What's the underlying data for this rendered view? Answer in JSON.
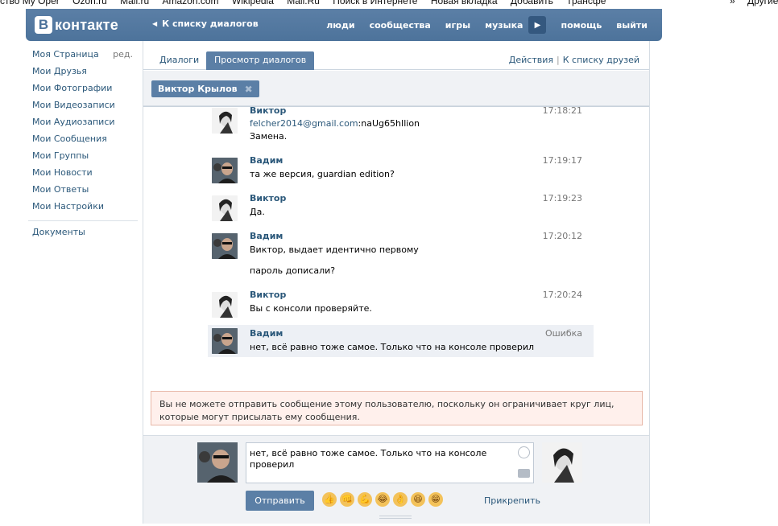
{
  "bookmarks": {
    "items": [
      "ство My Oper",
      "Ozon.ru",
      "Mail.ru",
      "Amazon.com",
      "Wikipedia",
      "Mail.Ru",
      "Поиск в Интернете",
      "Новая вкладка",
      "Добавить",
      "Трансфе"
    ],
    "more": "»",
    "other": "Другие"
  },
  "header": {
    "logo_letter": "B",
    "logo_text": "контакте",
    "back_link": "К списку диалогов",
    "nav": [
      "люди",
      "сообщества",
      "игры",
      "музыка",
      "помощь",
      "выйти"
    ]
  },
  "sidebar": {
    "items": [
      {
        "label": "Моя Страница",
        "extra": "ред."
      },
      {
        "label": "Мои Друзья"
      },
      {
        "label": "Мои Фотографии"
      },
      {
        "label": "Мои Видеозаписи"
      },
      {
        "label": "Мои Аудиозаписи"
      },
      {
        "label": "Мои Сообщения"
      },
      {
        "label": "Мои Группы"
      },
      {
        "label": "Мои Новости"
      },
      {
        "label": "Мои Ответы"
      },
      {
        "label": "Мои Настройки"
      }
    ],
    "documents": "Документы"
  },
  "tabs": {
    "dialogs": "Диалоги",
    "view": "Просмотр диалогов",
    "actions": "Действия",
    "separator": "|",
    "friends_link": "К списку друзей"
  },
  "filter": {
    "chip_label": "Виктор Крылов",
    "chip_close": "✖"
  },
  "messages": [
    {
      "from": "Виктор",
      "time": "17:18:21",
      "email": "felcher2014@gmail.com",
      "line1_rest": ":naUg65hIlion",
      "line2": "Замена."
    },
    {
      "from": "Вадим",
      "time": "17:19:17",
      "line1": "та же версия, guardian edition?"
    },
    {
      "from": "Виктор",
      "time": "17:19:23",
      "line1": "Да."
    },
    {
      "from": "Вадим",
      "time": "17:20:12",
      "line1": "Виктор, выдает идентично первому",
      "line2": "пароль дописали?"
    },
    {
      "from": "Виктор",
      "time": "17:20:24",
      "line1": "Вы с консоли проверяйте."
    },
    {
      "from": "Вадим",
      "time": "Ошибка",
      "line1": "нет, всё равно тоже самое. Только что на консоле проверил"
    }
  ],
  "warning": "Вы не можете отправить сообщение этому пользователю, поскольку он ограничивает круг лиц, которые могут присылать ему сообщения.",
  "composer": {
    "text": "нет, всё равно тоже самое. Только что на консоле проверил",
    "send_label": "Отправить",
    "attach_label": "Прикрепить",
    "emojis": [
      "👍",
      "👊",
      "💪",
      "😂",
      "👌",
      "😆",
      "😁"
    ]
  },
  "colors": {
    "header": "#5b7fa6",
    "link": "#2b587a",
    "warning_bg": "#fff0ec"
  }
}
